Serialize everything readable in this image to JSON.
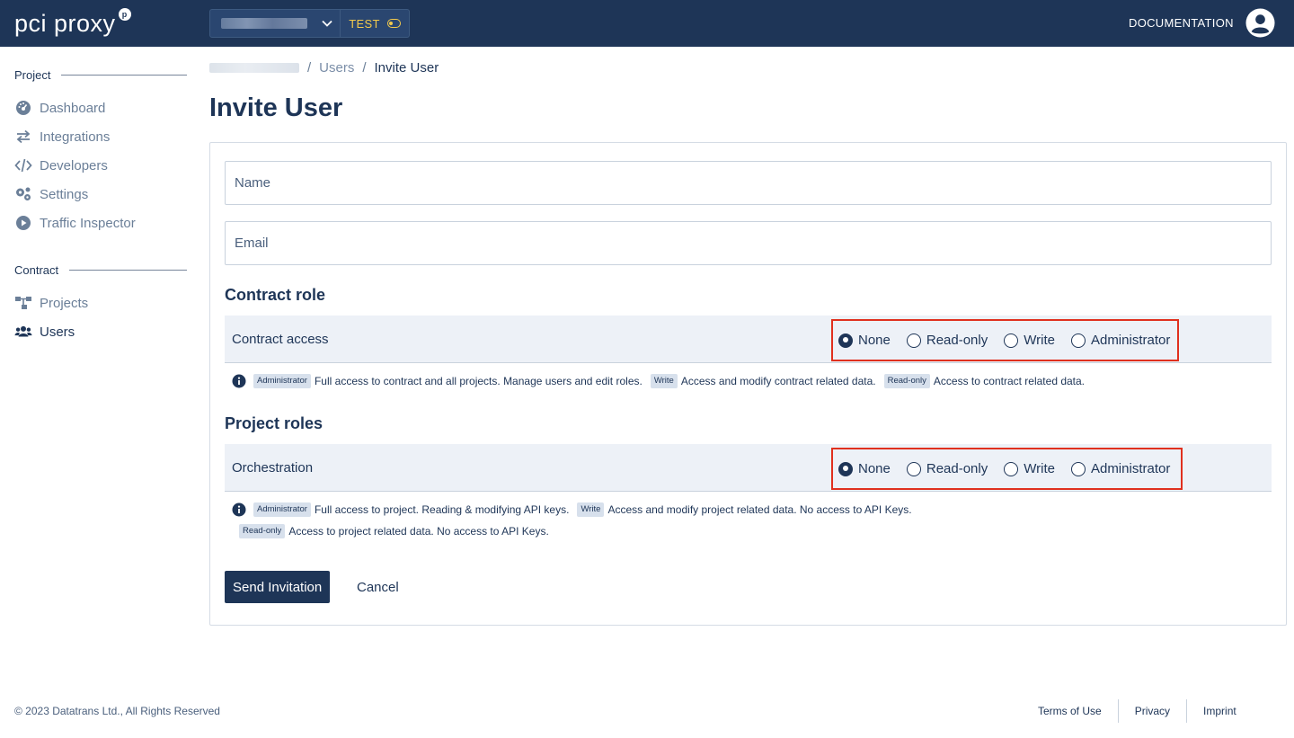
{
  "header": {
    "logo_text": "pci proxy",
    "logo_badge": "p",
    "env_label": "TEST",
    "documentation_label": "DOCUMENTATION"
  },
  "sidebar": {
    "sections": [
      {
        "title": "Project",
        "items": [
          {
            "label": "Dashboard",
            "icon": "dashboard-icon"
          },
          {
            "label": "Integrations",
            "icon": "arrows-exchange-icon"
          },
          {
            "label": "Developers",
            "icon": "code-icon"
          },
          {
            "label": "Settings",
            "icon": "gears-icon"
          },
          {
            "label": "Traffic Inspector",
            "icon": "play-circle-icon"
          }
        ]
      },
      {
        "title": "Contract",
        "items": [
          {
            "label": "Projects",
            "icon": "sitemap-icon"
          },
          {
            "label": "Users",
            "icon": "users-icon",
            "active": true
          }
        ]
      }
    ]
  },
  "breadcrumb": {
    "users": "Users",
    "current": "Invite User",
    "separator": "/"
  },
  "page_title": "Invite User",
  "form": {
    "name_placeholder": "Name",
    "email_placeholder": "Email",
    "contract_role_title": "Contract role",
    "contract_access_label": "Contract access",
    "project_roles_title": "Project roles",
    "project_label": "Orchestration",
    "role_options": [
      "None",
      "Read-only",
      "Write",
      "Administrator"
    ],
    "contract_selected": "None",
    "project_selected": "None",
    "contract_info": [
      {
        "tag": "Administrator",
        "text": "Full access to contract and all projects. Manage users and edit roles."
      },
      {
        "tag": "Write",
        "text": "Access and modify contract related data."
      },
      {
        "tag": "Read-only",
        "text": "Access to contract related data."
      }
    ],
    "project_info": [
      {
        "tag": "Administrator",
        "text": "Full access to project. Reading & modifying API keys."
      },
      {
        "tag": "Write",
        "text": "Access and modify project related data. No access to API Keys."
      },
      {
        "tag": "Read-only",
        "text": "Access to project related data. No access to API Keys."
      }
    ],
    "send_label": "Send Invitation",
    "cancel_label": "Cancel"
  },
  "footer": {
    "copyright": "© 2023 Datatrans Ltd., All Rights Reserved",
    "links": [
      "Terms of Use",
      "Privacy",
      "Imprint"
    ]
  },
  "colors": {
    "brand": "#1e3557",
    "highlight": "#e0301e",
    "test_env": "#f2c94c"
  }
}
